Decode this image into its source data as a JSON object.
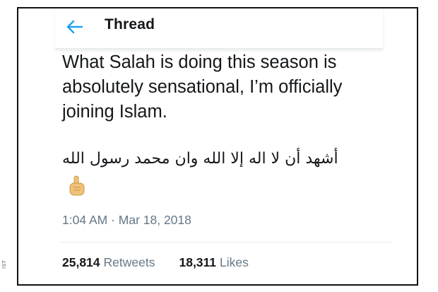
{
  "header": {
    "title": "Thread",
    "back_icon": "arrow-left-icon",
    "accent_color": "#1da1f2"
  },
  "tweet": {
    "text": "What Salah is doing this season is absolutely sensational, I’m officially joining Islam.",
    "arabic_text": "أشهد أن لا اله إلا الله وان محمد رسول الله",
    "emoji_icon": "index-pointing-up-icon",
    "timestamp": "1:04 AM · Mar 18, 2018"
  },
  "stats": {
    "retweets_count": "25,814",
    "retweets_label": "Retweets",
    "likes_count": "18,311",
    "likes_label": "Likes"
  },
  "credit": "IST",
  "colors": {
    "text": "#14171a",
    "secondary_text": "#657786",
    "divider": "#e6ecf0",
    "frame_border": "#111111"
  }
}
